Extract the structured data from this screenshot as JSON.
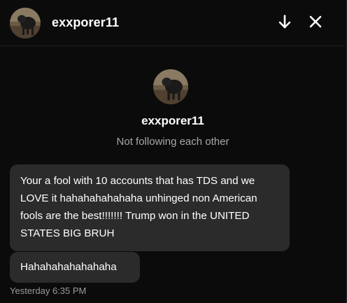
{
  "header": {
    "username": "exxporer11",
    "avatar_icon": "dog-avatar",
    "scroll_down_icon": "arrow-down-icon",
    "close_icon": "close-icon"
  },
  "profile": {
    "username": "exxporer11",
    "avatar_icon": "dog-avatar",
    "follow_status": "Not following each other"
  },
  "messages": [
    {
      "text": "Your a fool with 10 accounts that has TDS and we LOVE it hahahahahahaha unhinged non American fools are the best!!!!!!! Trump won in the UNITED STATES BIG BRUH"
    },
    {
      "text": "Hahahahahahahaha"
    }
  ],
  "last_message_time": "Yesterday 6:35 PM",
  "colors": {
    "background": "#0b0b0b",
    "bubble": "#2b2b2b",
    "text": "#ffffff",
    "secondary_text": "#a8a8a8"
  }
}
